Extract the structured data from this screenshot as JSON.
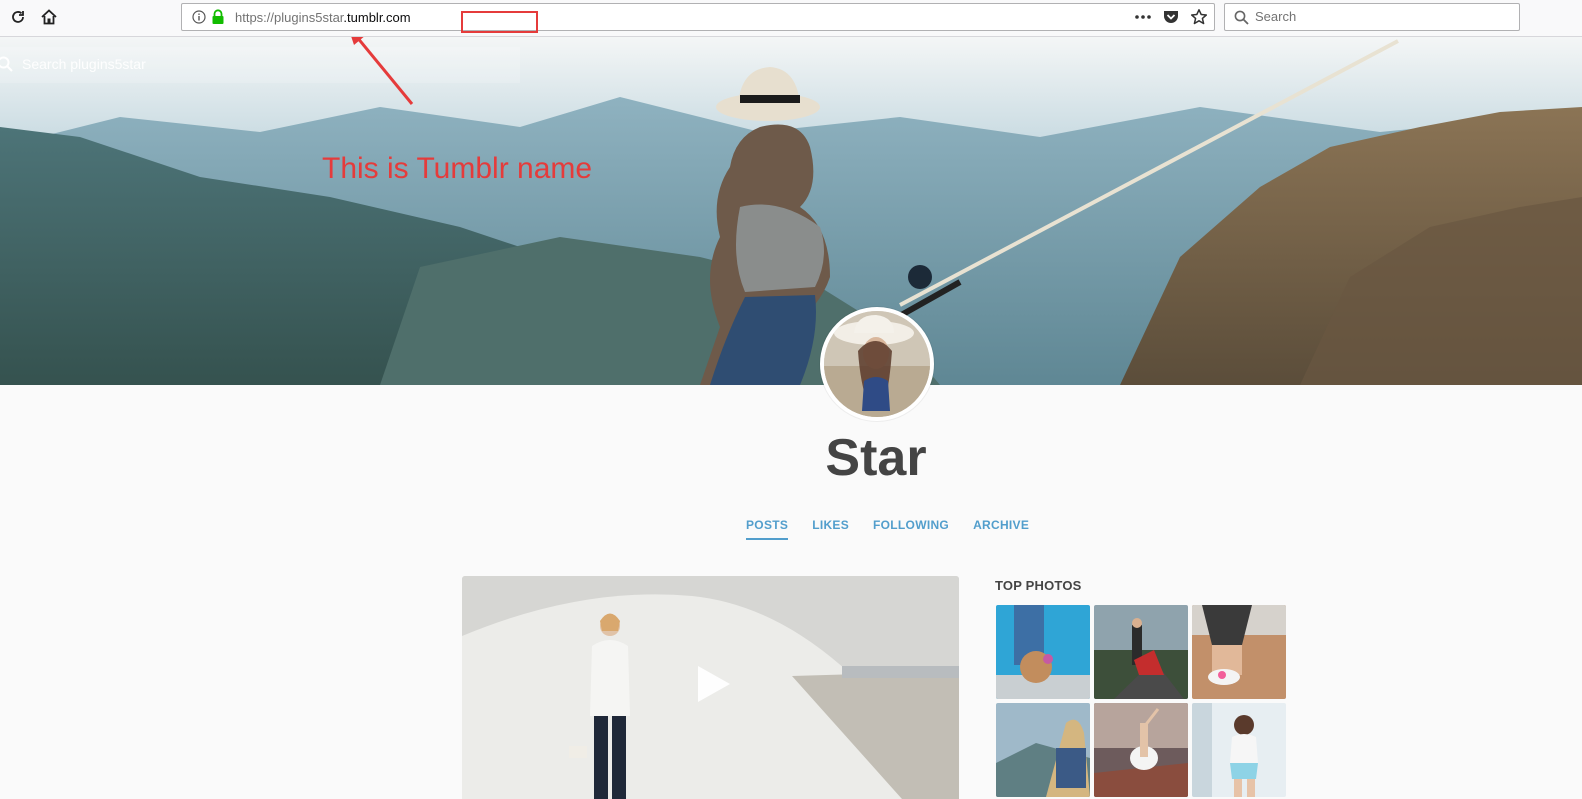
{
  "browser": {
    "url_protocol": "https://",
    "url_subdomain": "plugins5star",
    "url_domain": ".tumblr.com",
    "search_placeholder": "Search"
  },
  "hero": {
    "search_placeholder": "Search plugins5star"
  },
  "annotation": {
    "text": "This is Tumblr name",
    "color": "#e53b3b"
  },
  "blog": {
    "title": "Star"
  },
  "nav": {
    "items": [
      {
        "label": "POSTS",
        "active": true
      },
      {
        "label": "LIKES",
        "active": false
      },
      {
        "label": "FOLLOWING",
        "active": false
      },
      {
        "label": "ARCHIVE",
        "active": false
      }
    ],
    "accent_color": "#529ecc"
  },
  "sidebar": {
    "top_photos_title": "TOP PHOTOS"
  },
  "icons": [
    "reload-icon",
    "home-icon",
    "info-icon",
    "lock-icon",
    "more-icon",
    "pocket-icon",
    "bookmark-star-icon",
    "search-icon",
    "play-icon"
  ]
}
